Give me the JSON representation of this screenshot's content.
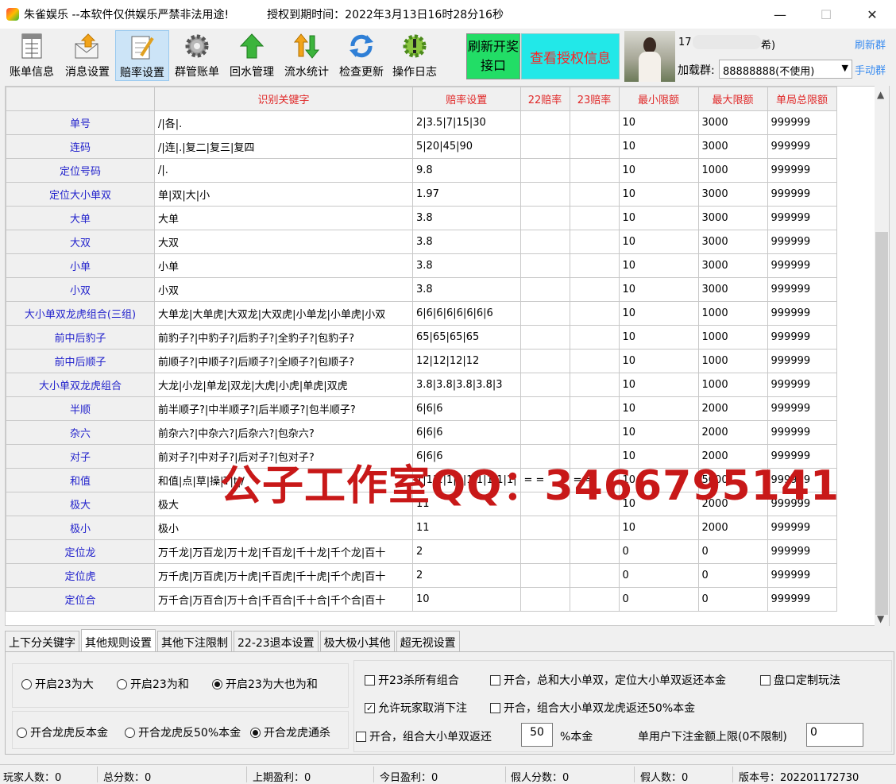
{
  "window": {
    "title": "朱雀娱乐 --本软件仅供娱乐严禁非法用途!",
    "license_text": "授权到期时间：2022年3月13日16时28分16秒",
    "minimize": "—",
    "maximize": "☐",
    "close": "✕"
  },
  "toolbar": {
    "items": [
      {
        "label": "账单信息",
        "icon": "ledger-icon"
      },
      {
        "label": "消息设置",
        "icon": "message-icon"
      },
      {
        "label": "赔率设置",
        "icon": "notepad-icon"
      },
      {
        "label": "群管账单",
        "icon": "gear-icon"
      },
      {
        "label": "回水管理",
        "icon": "up-arrow-icon"
      },
      {
        "label": "流水统计",
        "icon": "updown-arrows-icon"
      },
      {
        "label": "检查更新",
        "icon": "refresh-icon"
      },
      {
        "label": "操作日志",
        "icon": "warning-gear-icon"
      }
    ],
    "refresh_button": "刷新开奖接口",
    "auth_button": "查看授权信息"
  },
  "account": {
    "id_prefix": "17",
    "id_suffix": "希)",
    "group_label": "加载群:",
    "group_value": "88888888(不使用)",
    "refresh_group": "刷新群",
    "manual_group": "手动群"
  },
  "grid": {
    "columns": [
      "",
      "识别关键字",
      "赔率设置",
      "22赔率",
      "23赔率",
      "最小限额",
      "最大限额",
      "单局总限额"
    ],
    "rows": [
      [
        "单号",
        "/|各|.",
        "2|3.5|7|15|30",
        "",
        "",
        "10",
        "3000",
        "999999"
      ],
      [
        "连码",
        "/|连|.|复二|复三|复四",
        "5|20|45|90",
        "",
        "",
        "10",
        "3000",
        "999999"
      ],
      [
        "定位号码",
        "/|.",
        "9.8",
        "",
        "",
        "10",
        "1000",
        "999999"
      ],
      [
        "定位大小单双",
        "单|双|大|小",
        "1.97",
        "",
        "",
        "10",
        "3000",
        "999999"
      ],
      [
        "大单",
        "大单",
        "3.8",
        "",
        "",
        "10",
        "3000",
        "999999"
      ],
      [
        "大双",
        "大双",
        "3.8",
        "",
        "",
        "10",
        "3000",
        "999999"
      ],
      [
        "小单",
        "小单",
        "3.8",
        "",
        "",
        "10",
        "3000",
        "999999"
      ],
      [
        "小双",
        "小双",
        "3.8",
        "",
        "",
        "10",
        "3000",
        "999999"
      ],
      [
        "大小单双龙虎组合(三组)",
        "大单龙|大单虎|大双龙|大双虎|小单龙|小单虎|小双",
        "6|6|6|6|6|6|6|6",
        "",
        "",
        "10",
        "1000",
        "999999"
      ],
      [
        "前中后豹子",
        "前豹子?|中豹子?|后豹子?|全豹子?|包豹子?",
        "65|65|65|65",
        "",
        "",
        "10",
        "1000",
        "999999"
      ],
      [
        "前中后顺子",
        "前顺子?|中顺子?|后顺子?|全顺子?|包顺子?",
        "12|12|12|12",
        "",
        "",
        "10",
        "1000",
        "999999"
      ],
      [
        "大小单双龙虎组合",
        "大龙|小龙|单龙|双龙|大虎|小虎|单虎|双虎",
        "3.8|3.8|3.8|3.8|3",
        "",
        "",
        "10",
        "1000",
        "999999"
      ],
      [
        "半顺",
        "前半顺子?|中半顺子?|后半顺子?|包半顺子?",
        "6|6|6",
        "",
        "",
        "10",
        "2000",
        "999999"
      ],
      [
        "杂六",
        "前杂六?|中杂六?|后杂六?|包杂六?",
        "6|6|6",
        "",
        "",
        "10",
        "2000",
        "999999"
      ],
      [
        "对子",
        "前对子?|中对子?|后对子?|包对子?",
        "6|6|6",
        "",
        "",
        "10",
        "2000",
        "999999"
      ],
      [
        "和值",
        "和值|点|草|操|T|t|/",
        "1|1|1|1|1|1|1|1|1|1|",
        "= =",
        "= =",
        "10",
        "5000",
        "999999"
      ],
      [
        "极大",
        "极大",
        "11",
        "",
        "",
        "10",
        "2000",
        "999999"
      ],
      [
        "极小",
        "极小",
        "11",
        "",
        "",
        "10",
        "2000",
        "999999"
      ],
      [
        "定位龙",
        "万千龙|万百龙|万十龙|千百龙|千十龙|千个龙|百十",
        "2",
        "",
        "",
        "0",
        "0",
        "999999"
      ],
      [
        "定位虎",
        "万千虎|万百虎|万十虎|千百虎|千十虎|千个虎|百十",
        "2",
        "",
        "",
        "0",
        "0",
        "999999"
      ],
      [
        "定位合",
        "万千合|万百合|万十合|千百合|千十合|千个合|百十",
        "10",
        "",
        "",
        "0",
        "0",
        "999999"
      ]
    ]
  },
  "watermark": "公子工作室QQ：3466795141",
  "tabs": [
    "上下分关键字",
    "其他规则设置",
    "其他下注限制",
    "22-23退本设置",
    "极大极小其他",
    "超无视设置"
  ],
  "options": {
    "r1": [
      "开启23为大",
      "开启23为和",
      "开启23为大也为和"
    ],
    "r2": [
      "开合龙虎反本金",
      "开合龙虎反50%本金",
      "开合龙虎通杀"
    ],
    "c_all23": "开23杀所有组合",
    "c_sum": "开合，总和大小单双，定位大小单双返还本金",
    "c_custom": "盘口定制玩法",
    "c_cancel": "允许玩家取消下注",
    "c_combo50": "开合，组合大小单双龙虎返还50%本金",
    "c_combo": "开合，组合大小单双返还",
    "combo_value": "50",
    "combo_suffix": "%本金",
    "limit_label": "单用户下注金额上限(0不限制)",
    "limit_value": "0"
  },
  "status": [
    "玩家人数：0",
    "总分数：0",
    "上期盈利：0",
    "今日盈利：0",
    "假人分数：0",
    "假人数：0",
    "版本号：202201172730"
  ]
}
